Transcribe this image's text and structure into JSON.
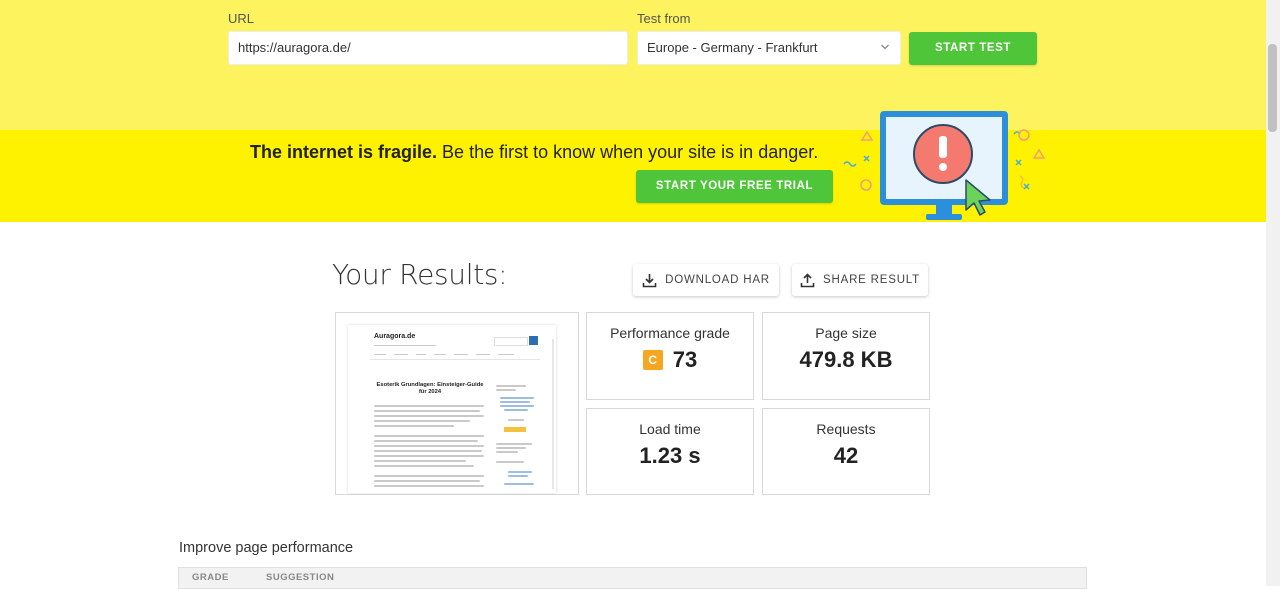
{
  "form": {
    "url_label": "URL",
    "url_value": "https://auragora.de/",
    "test_from_label": "Test from",
    "test_from_value": "Europe - Germany - Frankfurt",
    "start_test_label": "START TEST"
  },
  "promo": {
    "headline_bold": "The internet is fragile.",
    "headline_rest": " Be the first to know when your site is in danger.",
    "cta_label": "START YOUR FREE TRIAL"
  },
  "results": {
    "title": "Your Results:",
    "download_har_label": "DOWNLOAD HAR",
    "share_result_label": "SHARE RESULT",
    "performance_grade_label": "Performance grade",
    "performance_grade_letter": "C",
    "performance_grade_value": "73",
    "page_size_label": "Page size",
    "page_size_value": "479.8 KB",
    "load_time_label": "Load time",
    "load_time_value": "1.23 s",
    "requests_label": "Requests",
    "requests_value": "42"
  },
  "thumbnail": {
    "site_title": "Auragora.de",
    "article_heading": "Esoterik Grundlagen: Einsteiger-Guide für 2024"
  },
  "improve": {
    "title": "Improve page performance",
    "col_grade": "GRADE",
    "col_suggestion": "SUGGESTION"
  },
  "colors": {
    "top_band": "#fdf35f",
    "promo_band": "#fff200",
    "accent_green": "#4fc53a",
    "grade_c": "#f5a623"
  }
}
